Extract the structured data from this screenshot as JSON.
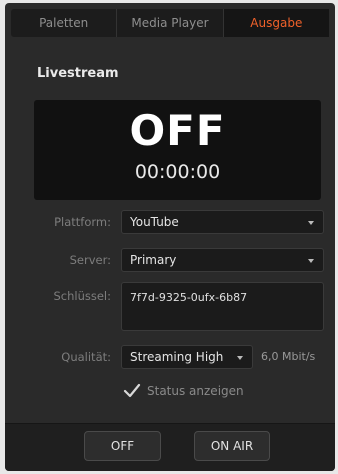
{
  "tabs": [
    {
      "label": "Paletten",
      "active": false
    },
    {
      "label": "Media Player",
      "active": false
    },
    {
      "label": "Ausgabe",
      "active": true
    }
  ],
  "colors": {
    "accent": "#f0612a"
  },
  "section_title": "Livestream",
  "status": {
    "state": "OFF",
    "timecode": "00:00:00"
  },
  "fields": {
    "platform": {
      "label": "Plattform:",
      "value": "YouTube"
    },
    "server": {
      "label": "Server:",
      "value": "Primary"
    },
    "key": {
      "label": "Schlüssel:",
      "value": "7f7d-9325-0ufx-6b87"
    },
    "quality": {
      "label": "Qualität:",
      "value": "Streaming High",
      "bitrate": "6,0 Mbit/s"
    }
  },
  "show_status": {
    "label": "Status anzeigen",
    "checked": true
  },
  "buttons": {
    "off": "OFF",
    "on_air": "ON AIR"
  }
}
